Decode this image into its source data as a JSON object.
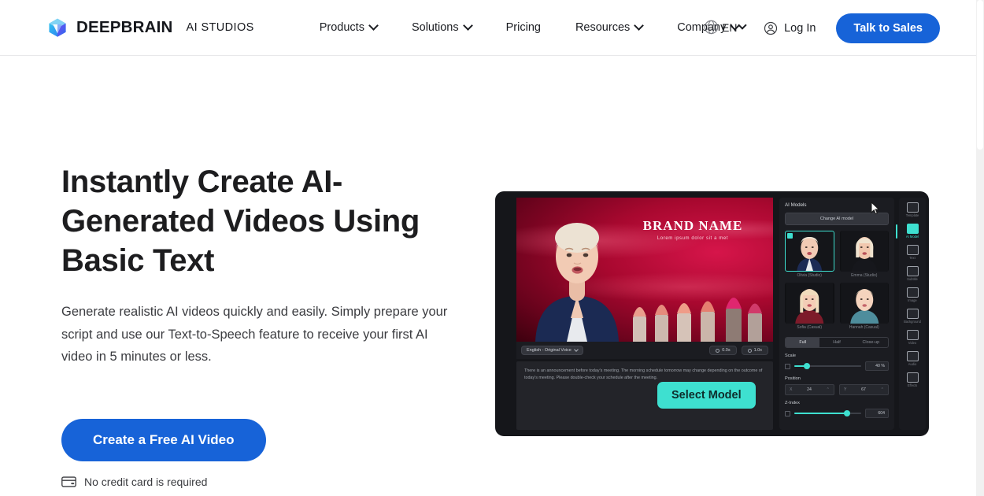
{
  "brand": {
    "name": "DEEPBRAIN",
    "suffix": "AI STUDIOS",
    "logo_icon": "cube-logo-icon",
    "logo_colors": [
      "#2b6ef0",
      "#7b3ff0",
      "#28c8e8"
    ]
  },
  "nav": {
    "items": [
      {
        "label": "Products",
        "has_dropdown": true
      },
      {
        "label": "Solutions",
        "has_dropdown": true
      },
      {
        "label": "Pricing",
        "has_dropdown": false
      },
      {
        "label": "Resources",
        "has_dropdown": true
      },
      {
        "label": "Company",
        "has_dropdown": true
      }
    ]
  },
  "header_right": {
    "language": {
      "code": "EN",
      "icon": "globe-icon"
    },
    "login_label": "Log In",
    "login_icon": "user-circle-icon",
    "cta_label": "Talk to Sales",
    "cta_color": "#1763d8"
  },
  "hero": {
    "title": "Instantly Create AI-Generated Videos Using Basic Text",
    "subtitle": "Generate realistic AI videos quickly and easily. Simply prepare your script and use our Text-to-Speech feature to receive your first AI video in 5 minutes or less.",
    "cta_label": "Create a Free AI Video",
    "cta_color": "#1763d8",
    "note": "No credit card is required",
    "note_icon": "credit-card-icon"
  },
  "mock": {
    "video": {
      "brand_name": "BRAND NAME",
      "brand_tagline": "Lorem ipsum dolor sit a met"
    },
    "script_bar": {
      "language_chip": "English - Original Voice",
      "duration_pill": "0.0s",
      "speed_pill": "1.0x"
    },
    "script_text": "There is an announcement before today's meeting. The morning schedule tomorrow may change depending on the outcome of today's meeting. Please double-check your schedule after the meeting.",
    "select_model_button": {
      "label": "Select Model",
      "color": "#3ee0d0"
    },
    "panel": {
      "title": "AI Models",
      "change_button": "Change AI model",
      "models": [
        {
          "name": "Olivia (Studio)",
          "selected": true
        },
        {
          "name": "Emma (Studio)",
          "selected": false
        },
        {
          "name": "Sofia (Casual)",
          "selected": false
        },
        {
          "name": "Hannah (Casual)",
          "selected": false
        }
      ],
      "size_tabs": [
        {
          "label": "Full",
          "active": true
        },
        {
          "label": "Half",
          "active": false
        },
        {
          "label": "Close-up",
          "active": false
        }
      ],
      "controls": [
        {
          "label": "Scale",
          "value": "40 %",
          "fill": 18
        },
        {
          "label": "Position",
          "x": "24",
          "y": "67"
        },
        {
          "label": "Z-Index",
          "value": "604",
          "fill": 78
        }
      ]
    },
    "rail": [
      {
        "label": "Template",
        "icon": "template-icon",
        "active": false
      },
      {
        "label": "AI Model",
        "icon": "person-icon",
        "active": true
      },
      {
        "label": "Text",
        "icon": "text-icon",
        "active": false
      },
      {
        "label": "Subtitle",
        "icon": "subtitle-icon",
        "active": false
      },
      {
        "label": "Image",
        "icon": "image-icon",
        "active": false
      },
      {
        "label": "Background",
        "icon": "background-icon",
        "active": false
      },
      {
        "label": "Video",
        "icon": "video-icon",
        "active": false
      },
      {
        "label": "Audio",
        "icon": "audio-icon",
        "active": false
      },
      {
        "label": "Effects",
        "icon": "effects-icon",
        "active": false
      }
    ]
  }
}
